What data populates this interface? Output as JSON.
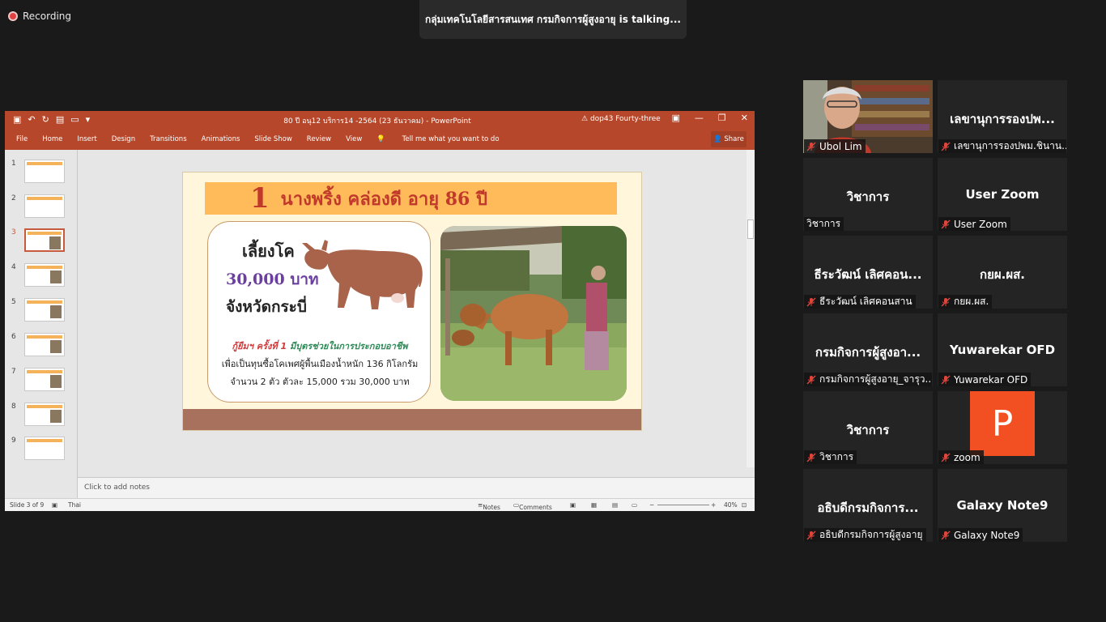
{
  "recording": {
    "label": "Recording"
  },
  "talking": {
    "text": "กลุ่มเทคโนโลยีสารสนเทศ กรมกิจการผู้สูงอายุ  is  talking..."
  },
  "ppt": {
    "doc_title": "80 ปี อนุ12 บริการ14 -2564 (23 ธันวาคม)  -  PowerPoint",
    "warning": "dop43 Fourty-three",
    "tabs": [
      "File",
      "Home",
      "Insert",
      "Design",
      "Transitions",
      "Animations",
      "Slide Show",
      "Review",
      "View",
      "Tell me what you want to do"
    ],
    "share": "Share",
    "thumbnails": [
      "1",
      "2",
      "3",
      "4",
      "5",
      "6",
      "7",
      "8",
      "9"
    ],
    "selected_slide": 3,
    "notes_placeholder": "Click to add notes",
    "status": {
      "slide": "Slide 3 of 9",
      "lang": "Thai",
      "notes": "Notes",
      "comments": "Comments",
      "zoom": "40%"
    }
  },
  "slide": {
    "number": "1",
    "title": "นางพริ้ง  คล่องดี  อายุ 86 ปี",
    "line1": "เลี้ยงโค",
    "amount": "30,000 บาท",
    "province": "จังหวัดกระบี่",
    "loan_red": "กู้ยืมฯ ครั้งที่ 1",
    "loan_green": " มีบุตรช่วยในการประกอบอาชีพ",
    "desc1": "เพื่อเป็นทุนซื้อโคเพศผู้พื้นเมืองน้ำหนัก 136 กิโลกรัม",
    "desc2": "จำนวน 2 ตัว ตัวละ 15,000 รวม 30,000 บาท"
  },
  "participants": [
    {
      "big": "",
      "label": "Ubol Lim",
      "video": true
    },
    {
      "big": "เลขานุการรองปพ...",
      "label": "เลขานุการรองปพม.ชินาน..."
    },
    {
      "big": "วิชาการ",
      "label": "วิชาการ",
      "unmuted": true
    },
    {
      "big": "User Zoom",
      "label": "User Zoom"
    },
    {
      "big": "ธีระวัฒน์ เลิศคอน...",
      "label": "ธีระวัฒน์ เลิศคอนสาน"
    },
    {
      "big": "กยผ.ผส.",
      "label": "กยผ.ผส."
    },
    {
      "big": "กรมกิจการผู้สูงอา...",
      "label": "กรมกิจการผู้สูงอายุ_จารุว..."
    },
    {
      "big": "Yuwarekar OFD",
      "label": "Yuwarekar OFD"
    },
    {
      "big": "วิชาการ",
      "label": "วิชาการ"
    },
    {
      "big": "P",
      "label": "zoom",
      "avatar": true
    },
    {
      "big": "อธิบดีกรมกิจการ...",
      "label": "อธิบดีกรมกิจการผู้สูงอายุ"
    },
    {
      "big": "Galaxy Note9",
      "label": "Galaxy Note9"
    }
  ],
  "colors": {
    "ppt_accent": "#b7472a",
    "mic_muted": "#e0443a",
    "avatar": "#f25022"
  }
}
